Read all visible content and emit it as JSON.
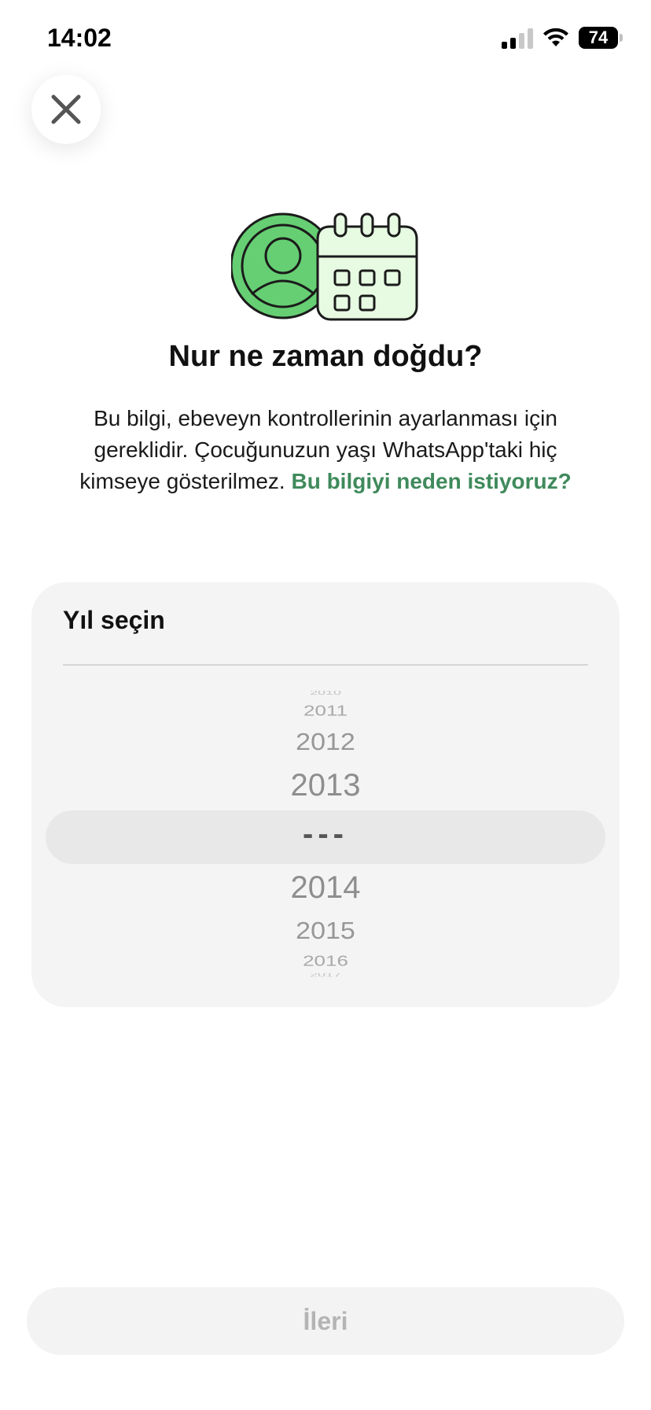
{
  "status_bar": {
    "time": "14:02",
    "battery": "74",
    "battery_level": 0.74,
    "icons": [
      "signal-icon",
      "wifi-icon",
      "battery-icon"
    ]
  },
  "header": {
    "close_icon": "close-icon"
  },
  "illustration": {
    "icons": [
      "profile-icon",
      "calendar-icon"
    ],
    "colors": {
      "green": "#66cf73",
      "light_green": "#e6fbe2",
      "outline": "#1b1b1b"
    }
  },
  "content": {
    "title": "Nur ne zaman doğdu?",
    "description": "Bu bilgi, ebeveyn kontrollerinin ayarlanması için gereklidir. Çocuğunuzun yaşı WhatsApp'taki hiç kimseye gösterilmez.",
    "link": "Bu bilgiyi neden istiyoruz?",
    "link_color": "#3f8a5c"
  },
  "picker": {
    "label": "Yıl seçin",
    "years_above": [
      "2010",
      "2011",
      "2012",
      "2013"
    ],
    "selected": "---",
    "years_below": [
      "2014",
      "2015",
      "2016",
      "2017"
    ]
  },
  "footer": {
    "next_label": "İleri"
  }
}
